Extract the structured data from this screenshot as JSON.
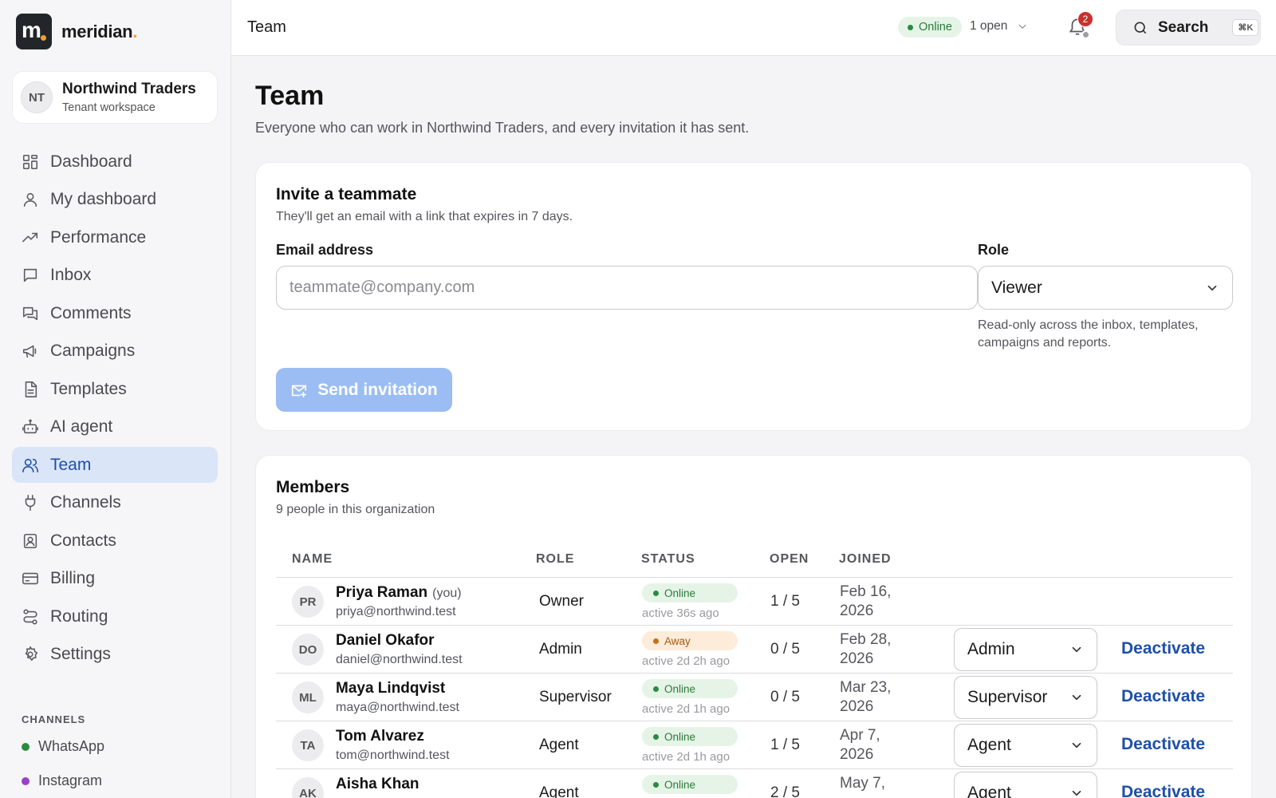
{
  "brand": {
    "logo_letter": "m",
    "name": "meridian",
    "dot": "."
  },
  "tenant": {
    "initials": "NT",
    "name": "Northwind Traders",
    "subtitle": "Tenant workspace"
  },
  "nav": [
    {
      "label": "Dashboard",
      "icon": "grid-icon"
    },
    {
      "label": "My dashboard",
      "icon": "user-icon"
    },
    {
      "label": "Performance",
      "icon": "trend-icon"
    },
    {
      "label": "Inbox",
      "icon": "chat-icon"
    },
    {
      "label": "Comments",
      "icon": "comments-icon"
    },
    {
      "label": "Campaigns",
      "icon": "megaphone-icon"
    },
    {
      "label": "Templates",
      "icon": "document-icon"
    },
    {
      "label": "AI agent",
      "icon": "bot-icon"
    },
    {
      "label": "Team",
      "icon": "users-icon",
      "active": true
    },
    {
      "label": "Channels",
      "icon": "plug-icon"
    },
    {
      "label": "Contacts",
      "icon": "contact-card-icon"
    },
    {
      "label": "Billing",
      "icon": "credit-card-icon"
    },
    {
      "label": "Routing",
      "icon": "routing-icon"
    },
    {
      "label": "Settings",
      "icon": "gear-icon"
    }
  ],
  "channels": {
    "heading": "CHANNELS",
    "items": [
      {
        "label": "WhatsApp",
        "color": "#2b8a3e"
      },
      {
        "label": "Instagram",
        "color": "#9b3fc9"
      }
    ]
  },
  "topbar": {
    "title": "Team",
    "status": "Online",
    "open_label": "1 open",
    "notifications": "2",
    "search_label": "Search",
    "search_shortcut": "⌘K"
  },
  "page": {
    "title": "Team",
    "subtitle": "Everyone who can work in Northwind Traders, and every invitation it has sent."
  },
  "invite": {
    "title": "Invite a teammate",
    "subtitle": "They'll get an email with a link that expires in 7 days.",
    "email_label": "Email address",
    "email_placeholder": "teammate@company.com",
    "email_value": "",
    "role_label": "Role",
    "role_value": "Viewer",
    "role_help": "Read-only across the inbox, templates, campaigns and reports.",
    "send_label": "Send invitation"
  },
  "members": {
    "title": "Members",
    "subtitle": "9 people in this organization",
    "columns": {
      "name": "NAME",
      "role": "ROLE",
      "status": "STATUS",
      "open": "OPEN",
      "joined": "JOINED"
    },
    "rows": [
      {
        "initials": "PR",
        "name": "Priya Raman",
        "you": "(you)",
        "email": "priya@northwind.test",
        "role": "Owner",
        "status": "Online",
        "status_kind": "online",
        "active": "active 36s ago",
        "open": "1 / 5",
        "joined": "Feb 16, 2026",
        "select": "",
        "action": ""
      },
      {
        "initials": "DO",
        "name": "Daniel Okafor",
        "you": "",
        "email": "daniel@northwind.test",
        "role": "Admin",
        "status": "Away",
        "status_kind": "away",
        "active": "active 2d 2h ago",
        "open": "0 / 5",
        "joined": "Feb 28, 2026",
        "select": "Admin",
        "action": "Deactivate"
      },
      {
        "initials": "ML",
        "name": "Maya Lindqvist",
        "you": "",
        "email": "maya@northwind.test",
        "role": "Supervisor",
        "status": "Online",
        "status_kind": "online",
        "active": "active 2d 1h ago",
        "open": "0 / 5",
        "joined": "Mar 23, 2026",
        "select": "Supervisor",
        "action": "Deactivate"
      },
      {
        "initials": "TA",
        "name": "Tom Alvarez",
        "you": "",
        "email": "tom@northwind.test",
        "role": "Agent",
        "status": "Online",
        "status_kind": "online",
        "active": "active 2d 1h ago",
        "open": "1 / 5",
        "joined": "Apr 7, 2026",
        "select": "Agent",
        "action": "Deactivate"
      },
      {
        "initials": "AK",
        "name": "Aisha Khan",
        "you": "",
        "email": "",
        "role": "Agent",
        "status": "Online",
        "status_kind": "online",
        "active": "",
        "open": "2 / 5",
        "joined": "May 7,",
        "select": "Agent",
        "action": "Deactivate"
      }
    ]
  }
}
